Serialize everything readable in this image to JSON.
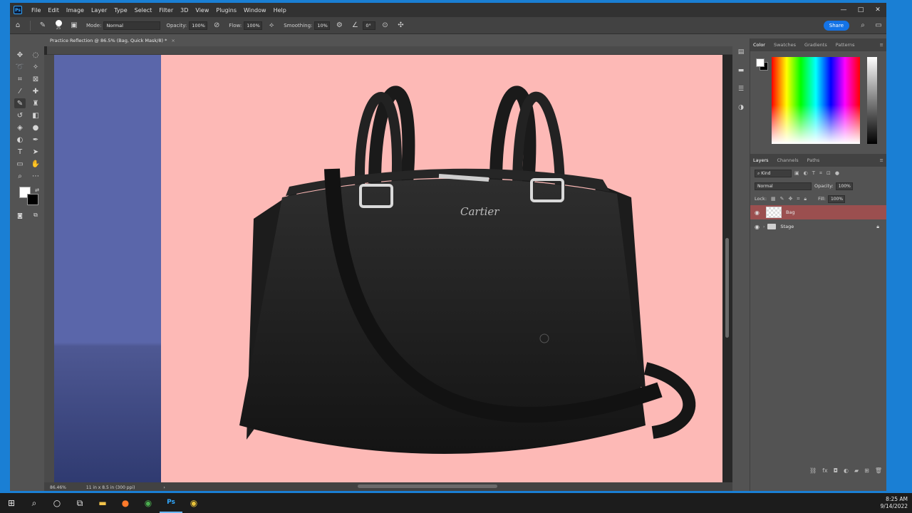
{
  "menubar": {
    "logo": "Ps",
    "items": [
      "File",
      "Edit",
      "Image",
      "Layer",
      "Type",
      "Select",
      "Filter",
      "3D",
      "View",
      "Plugins",
      "Window",
      "Help"
    ],
    "window_buttons": [
      "—",
      "□",
      "✕"
    ]
  },
  "options": {
    "brush_size": "25",
    "mode_label": "Mode:",
    "mode_value": "Normal",
    "opacity_label": "Opacity:",
    "opacity_value": "100%",
    "flow_label": "Flow:",
    "flow_value": "100%",
    "smoothing_label": "Smoothing:",
    "smoothing_value": "10%",
    "angle_value": "0°",
    "share_label": "Share"
  },
  "document": {
    "tab_title": "Practice Reflection @ 86.5% (Bag, Quick Mask/8) *",
    "tab_close": "×",
    "brand_text": "Cartier"
  },
  "status": {
    "zoom": "86.46%",
    "doc_size": "11 in x 8.5 in (300 ppi)",
    "arrow": "›"
  },
  "color_panel": {
    "tabs": [
      "Color",
      "Swatches",
      "Gradients",
      "Patterns"
    ],
    "fg": "#ffffff",
    "bg": "#000000"
  },
  "layers_panel": {
    "tabs": [
      "Layers",
      "Channels",
      "Paths"
    ],
    "kind_label": "Kind",
    "blend_mode": "Normal",
    "opacity_label": "Opacity:",
    "opacity_value": "100%",
    "lock_label": "Lock:",
    "fill_label": "Fill:",
    "fill_value": "100%",
    "layers": [
      {
        "name": "Bag",
        "selected": true
      },
      {
        "name": "Stage",
        "locked": true
      }
    ]
  },
  "taskbar": {
    "time": "8:25 AM",
    "date": "9/14/2022"
  },
  "colors": {
    "canvas_bg": "#fdb9b6",
    "left_panel": "#5a66aa",
    "selected_layer": "#9b4f4f",
    "share_button": "#1473e6"
  }
}
